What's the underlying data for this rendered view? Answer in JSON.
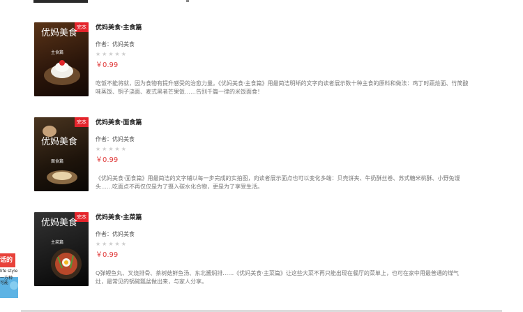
{
  "books": [
    {
      "badge": "完本",
      "cover_title": "优妈美食",
      "cover_sub": "主食篇",
      "title": "优妈美食·主食篇",
      "author": "作者：优妈美食",
      "stars": "★★★★★",
      "price": "￥0.99",
      "description": "吃饭不能将就，因为食物有提升感受的治愈力量。《优妈美食·主食篇》用最简洁明晰的文字向读者展示数十种主食的原料和做法：鸡丁时蔬烩面、竹筒酸味蒸饭、铜子浇面、麦式黑者芒果饭……告别千篇一律的米饭面食！",
      "colors": {
        "c1": "#4a2a14",
        "c2": "#1a0d06"
      }
    },
    {
      "badge": "完本",
      "cover_title": "优妈美食",
      "cover_sub": "面食篇",
      "title": "优妈美食·面食篇",
      "author": "作者：优妈美食",
      "stars": "★★★★★",
      "price": "￥0.99",
      "description": "《优妈美食·面食篇》用最简洁的文字辅以每一步完成的实拍图，向读者展示面点也可以变化多端：贝壳饼夹、牛奶酥丝卷、苏式糖米桃酥、小野兔馒头……吃面点不再仅仅是为了摄入碳水化合物，更是为了享受生活。",
      "colors": {
        "c1": "#3d2b1a",
        "c2": "#0f0a06"
      }
    },
    {
      "badge": "完本",
      "cover_title": "优妈美食",
      "cover_sub": "主菜篇",
      "title": "优妈美食·主菜篇",
      "author": "作者：优妈美食",
      "stars": "★★★★★",
      "price": "￥0.99",
      "description": "Q弹鲤鱼丸、叉烧排骨、茶树菇鲜鱼汤、东北酱焖排……《优妈美食·主菜篇》让这些大菜不再只能出现在餐厅的菜单上，也可在家中用最普通的煤气灶，最常见的锅碗瓢盆做出来，与家人分享。",
      "colors": {
        "c1": "#2c2c2c",
        "c2": "#0a0a0a"
      }
    }
  ],
  "chat_widget": {
    "lines": [
      "话的",
      "life style",
      "一方种",
      "可能"
    ]
  }
}
